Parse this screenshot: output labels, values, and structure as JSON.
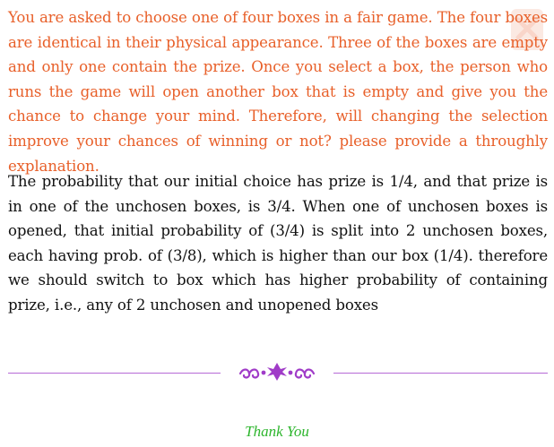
{
  "question": {
    "text": "You are asked to choose one of four boxes in a fair game. The four boxes are identical in their physical appearance. Three of the boxes are empty and only one contain the prize. Once you select a box, the person who runs the game will open another box that is empty and give you the chance to change your mind. Therefore, will changing the selection improve your chances of winning or not? please provide a throughly explanation.",
    "color": "#e8602a"
  },
  "answer": {
    "text": "The probability that our initial choice has prize is 1/4, and that prize is in one of the unchosen boxes, is 3/4. When one of unchosen boxes is opened, that initial probability of (3/4) is split into 2 unchosen boxes, each having prob. of (3/8), which is higher than our box (1/4). therefore we should switch to box which has higher probability of containing prize, i.e., any of 2 unchosen and unopened boxes",
    "color": "#111111"
  },
  "divider": {
    "ornament_icon": "floral-ornament-icon",
    "color": "#b76bd6"
  },
  "closing": {
    "text": "Thank You",
    "color": "#2db52d"
  },
  "watermark": {
    "icon": "logo-watermark-icon",
    "color": "#f2a58a"
  }
}
